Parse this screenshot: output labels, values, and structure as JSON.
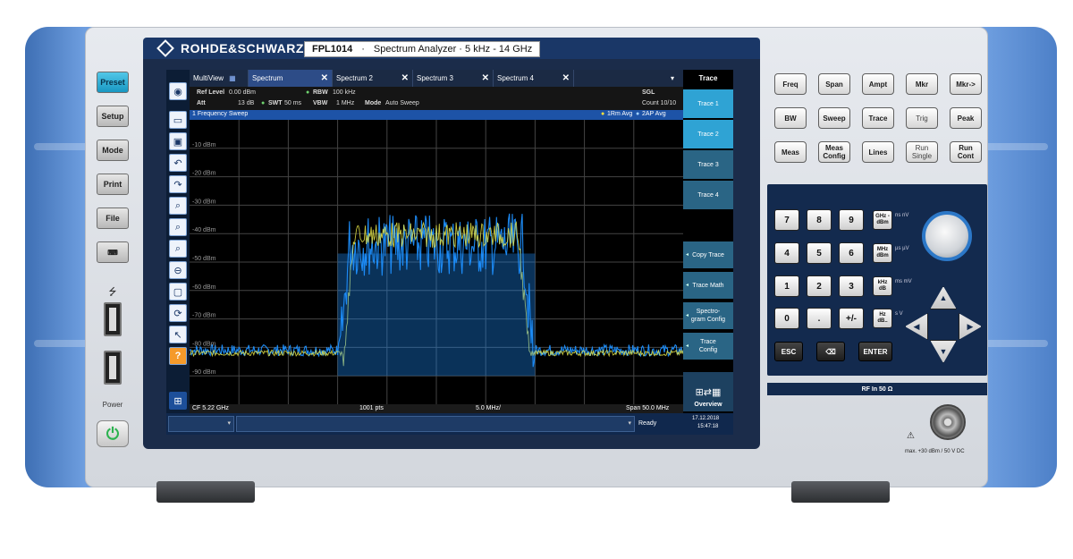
{
  "brand": "ROHDE&SCHWARZ",
  "model": {
    "name": "FPL1014",
    "separator": "·",
    "desc": "Spectrum Analyzer · 5 kHz - 14 GHz"
  },
  "left_buttons": {
    "preset": "Preset",
    "setup": "Setup",
    "mode": "Mode",
    "print": "Print",
    "file": "File",
    "power_label": "Power"
  },
  "tabs": [
    {
      "label": "MultiView"
    },
    {
      "label": "Spectrum"
    },
    {
      "label": "Spectrum 2"
    },
    {
      "label": "Spectrum 3"
    },
    {
      "label": "Spectrum 4"
    }
  ],
  "softkey_header": "Trace",
  "softkeys": [
    "Trace 1",
    "Trace 2",
    "Trace 3",
    "Trace 4",
    "Copy Trace",
    "Trace Math",
    "Spectro- gram Config",
    "Trace Config",
    "Overview"
  ],
  "params": {
    "ref_level_label": "Ref Level",
    "ref_level": "0.00 dBm",
    "att_label": "Att",
    "att": "13 dB",
    "swt_label": "SWT",
    "swt": "50 ms",
    "rbw_label": "RBW",
    "rbw": "100 kHz",
    "vbw_label": "VBW",
    "vbw": "1 MHz",
    "mode_label": "Mode",
    "mode": "Auto Sweep",
    "sgl": "SGL",
    "count": "Count 10/10"
  },
  "sweep": {
    "title": "1 Frequency Sweep",
    "trace1": "1Rm Avg",
    "trace2": "2AP Avg"
  },
  "y_labels": [
    "-10 dBm",
    "-20 dBm",
    "-30 dBm",
    "-40 dBm",
    "-50 dBm",
    "-60 dBm",
    "-70 dBm",
    "-80 dBm",
    "-90 dBm"
  ],
  "status": {
    "cf": "CF 5.22 GHz",
    "pts": "1001 pts",
    "div": "5.0 MHz/",
    "span": "Span 50.0 MHz"
  },
  "bottom": {
    "ready": "Ready",
    "date": "17.12.2018",
    "time": "15:47:18"
  },
  "hardkeys": [
    "Freq",
    "Span",
    "Ampt",
    "Mkr",
    "Mkr->",
    "BW",
    "Sweep",
    "Trace",
    "Trig",
    "Peak",
    "Meas",
    "Meas Config",
    "Lines",
    "Run Single",
    "Run Cont"
  ],
  "numkeys": [
    "7",
    "8",
    "9",
    "4",
    "5",
    "6",
    "1",
    "2",
    "3",
    "0",
    ".",
    "+/-"
  ],
  "unitkeys": [
    {
      "key": "GHz -dBm",
      "lbl": "ns nV"
    },
    {
      "key": "MHz dBm",
      "lbl": "µs µV"
    },
    {
      "key": "kHz dB",
      "lbl": "ms mV"
    },
    {
      "key": "Hz dB..",
      "lbl": "s V"
    }
  ],
  "esc": "ESC",
  "enter": "ENTER",
  "rf_in": "RF In 50 Ω",
  "rf_max": "max. +30 dBm / 50 V DC",
  "chart_data": {
    "type": "line",
    "title": "1 Frequency Sweep",
    "xlabel": "",
    "ylabel": "",
    "x_center_ghz": 5.22,
    "span_mhz": 50.0,
    "points": 1001,
    "xlim_mhz": [
      -25,
      25
    ],
    "ylim": [
      -100,
      0
    ],
    "y_ticks": [
      -10,
      -20,
      -30,
      -40,
      -50,
      -60,
      -70,
      -80,
      -90
    ],
    "grid": true,
    "legend_position": "top-right",
    "series": [
      {
        "name": "1Rm Avg",
        "color": "#1e90ff",
        "shape": "channel",
        "noise_floor_dbm": -81,
        "plateau_dbm": -33,
        "edges_mhz": [
          -10,
          10
        ]
      },
      {
        "name": "2AP Avg",
        "color": "#e9e94a",
        "shape": "channel",
        "noise_floor_dbm": -82,
        "plateau_dbm": -36,
        "edges_mhz": [
          -9.5,
          9.5
        ]
      }
    ]
  }
}
